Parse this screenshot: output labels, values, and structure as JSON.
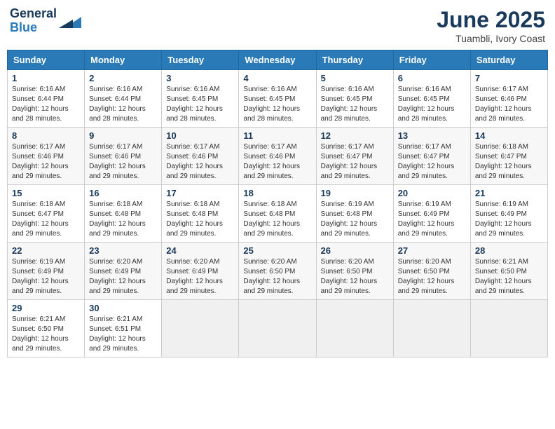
{
  "header": {
    "logo_line1": "General",
    "logo_line2": "Blue",
    "month_year": "June 2025",
    "location": "Tuambli, Ivory Coast"
  },
  "weekdays": [
    "Sunday",
    "Monday",
    "Tuesday",
    "Wednesday",
    "Thursday",
    "Friday",
    "Saturday"
  ],
  "weeks": [
    [
      {
        "day": "1",
        "sunrise": "6:16 AM",
        "sunset": "6:44 PM",
        "daylight": "12 hours and 28 minutes."
      },
      {
        "day": "2",
        "sunrise": "6:16 AM",
        "sunset": "6:44 PM",
        "daylight": "12 hours and 28 minutes."
      },
      {
        "day": "3",
        "sunrise": "6:16 AM",
        "sunset": "6:45 PM",
        "daylight": "12 hours and 28 minutes."
      },
      {
        "day": "4",
        "sunrise": "6:16 AM",
        "sunset": "6:45 PM",
        "daylight": "12 hours and 28 minutes."
      },
      {
        "day": "5",
        "sunrise": "6:16 AM",
        "sunset": "6:45 PM",
        "daylight": "12 hours and 28 minutes."
      },
      {
        "day": "6",
        "sunrise": "6:16 AM",
        "sunset": "6:45 PM",
        "daylight": "12 hours and 28 minutes."
      },
      {
        "day": "7",
        "sunrise": "6:17 AM",
        "sunset": "6:46 PM",
        "daylight": "12 hours and 28 minutes."
      }
    ],
    [
      {
        "day": "8",
        "sunrise": "6:17 AM",
        "sunset": "6:46 PM",
        "daylight": "12 hours and 29 minutes."
      },
      {
        "day": "9",
        "sunrise": "6:17 AM",
        "sunset": "6:46 PM",
        "daylight": "12 hours and 29 minutes."
      },
      {
        "day": "10",
        "sunrise": "6:17 AM",
        "sunset": "6:46 PM",
        "daylight": "12 hours and 29 minutes."
      },
      {
        "day": "11",
        "sunrise": "6:17 AM",
        "sunset": "6:46 PM",
        "daylight": "12 hours and 29 minutes."
      },
      {
        "day": "12",
        "sunrise": "6:17 AM",
        "sunset": "6:47 PM",
        "daylight": "12 hours and 29 minutes."
      },
      {
        "day": "13",
        "sunrise": "6:17 AM",
        "sunset": "6:47 PM",
        "daylight": "12 hours and 29 minutes."
      },
      {
        "day": "14",
        "sunrise": "6:18 AM",
        "sunset": "6:47 PM",
        "daylight": "12 hours and 29 minutes."
      }
    ],
    [
      {
        "day": "15",
        "sunrise": "6:18 AM",
        "sunset": "6:47 PM",
        "daylight": "12 hours and 29 minutes."
      },
      {
        "day": "16",
        "sunrise": "6:18 AM",
        "sunset": "6:48 PM",
        "daylight": "12 hours and 29 minutes."
      },
      {
        "day": "17",
        "sunrise": "6:18 AM",
        "sunset": "6:48 PM",
        "daylight": "12 hours and 29 minutes."
      },
      {
        "day": "18",
        "sunrise": "6:18 AM",
        "sunset": "6:48 PM",
        "daylight": "12 hours and 29 minutes."
      },
      {
        "day": "19",
        "sunrise": "6:19 AM",
        "sunset": "6:48 PM",
        "daylight": "12 hours and 29 minutes."
      },
      {
        "day": "20",
        "sunrise": "6:19 AM",
        "sunset": "6:49 PM",
        "daylight": "12 hours and 29 minutes."
      },
      {
        "day": "21",
        "sunrise": "6:19 AM",
        "sunset": "6:49 PM",
        "daylight": "12 hours and 29 minutes."
      }
    ],
    [
      {
        "day": "22",
        "sunrise": "6:19 AM",
        "sunset": "6:49 PM",
        "daylight": "12 hours and 29 minutes."
      },
      {
        "day": "23",
        "sunrise": "6:20 AM",
        "sunset": "6:49 PM",
        "daylight": "12 hours and 29 minutes."
      },
      {
        "day": "24",
        "sunrise": "6:20 AM",
        "sunset": "6:49 PM",
        "daylight": "12 hours and 29 minutes."
      },
      {
        "day": "25",
        "sunrise": "6:20 AM",
        "sunset": "6:50 PM",
        "daylight": "12 hours and 29 minutes."
      },
      {
        "day": "26",
        "sunrise": "6:20 AM",
        "sunset": "6:50 PM",
        "daylight": "12 hours and 29 minutes."
      },
      {
        "day": "27",
        "sunrise": "6:20 AM",
        "sunset": "6:50 PM",
        "daylight": "12 hours and 29 minutes."
      },
      {
        "day": "28",
        "sunrise": "6:21 AM",
        "sunset": "6:50 PM",
        "daylight": "12 hours and 29 minutes."
      }
    ],
    [
      {
        "day": "29",
        "sunrise": "6:21 AM",
        "sunset": "6:50 PM",
        "daylight": "12 hours and 29 minutes."
      },
      {
        "day": "30",
        "sunrise": "6:21 AM",
        "sunset": "6:51 PM",
        "daylight": "12 hours and 29 minutes."
      },
      null,
      null,
      null,
      null,
      null
    ]
  ]
}
